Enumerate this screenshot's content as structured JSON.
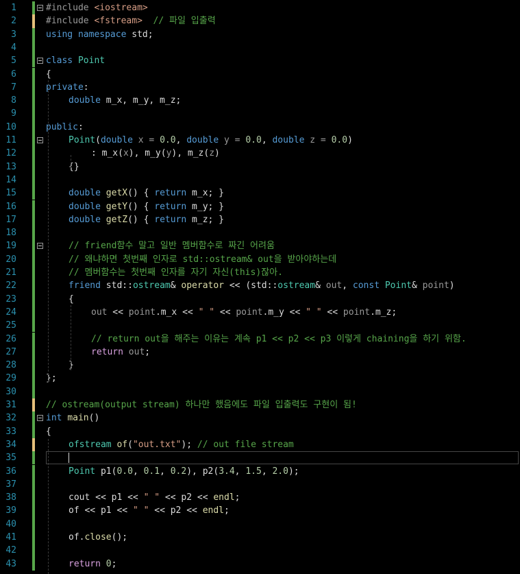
{
  "line_numbers": [
    "1",
    "2",
    "3",
    "4",
    "5",
    "6",
    "7",
    "8",
    "9",
    "10",
    "11",
    "12",
    "13",
    "14",
    "15",
    "16",
    "17",
    "18",
    "19",
    "20",
    "21",
    "22",
    "23",
    "24",
    "25",
    "26",
    "27",
    "28",
    "29",
    "30",
    "31",
    "32",
    "33",
    "34",
    "35",
    "36",
    "37",
    "38",
    "39",
    "40",
    "41",
    "42",
    "43"
  ],
  "code": {
    "l1": [
      "#include ",
      "<iostream>"
    ],
    "l2": [
      "#include ",
      "<fstream>",
      "  // 파일 입출력"
    ],
    "l3": [
      "using",
      " ",
      "namespace",
      " std;"
    ],
    "l5": [
      "class",
      " ",
      "Point"
    ],
    "l6": [
      "{"
    ],
    "l7": [
      "private",
      ":"
    ],
    "l8": [
      "double",
      " m_x, m_y, m_z;"
    ],
    "l10": [
      "public",
      ":"
    ],
    "l11": [
      "Point",
      "(",
      "double",
      " x = ",
      "0.0",
      ", ",
      "double",
      " y = ",
      "0.0",
      ", ",
      "double",
      " z = ",
      "0.0",
      ")"
    ],
    "l12": [
      ": m_x(",
      "x",
      "), m_y(",
      "y",
      "), m_z(",
      "z",
      ")"
    ],
    "l13": [
      "{}"
    ],
    "l15": [
      "double",
      " ",
      "getX",
      "() { ",
      "return",
      " m_x; }"
    ],
    "l16": [
      "double",
      " ",
      "getY",
      "() { ",
      "return",
      " m_y; }"
    ],
    "l17": [
      "double",
      " ",
      "getZ",
      "() { ",
      "return",
      " m_z; }"
    ],
    "l19": [
      "// friend함수 말고 일반 멤버함수로 짜긴 어려움"
    ],
    "l20": [
      "// 왜냐하면 첫번째 인자로 std::ostream& out을 받아야하는데"
    ],
    "l21": [
      "// 멤버함수는 첫번째 인자를 자기 자신(this)잖아."
    ],
    "l22": [
      "friend",
      " std::",
      "ostream",
      "& ",
      "operator",
      " << (std::",
      "ostream",
      "& ",
      "out",
      ", ",
      "const",
      " ",
      "Point",
      "& ",
      "point",
      ")"
    ],
    "l23": [
      "{"
    ],
    "l24": [
      "out",
      " << ",
      "point",
      ".m_x << ",
      "\" \"",
      " << ",
      "point",
      ".m_y << ",
      "\" \"",
      " << ",
      "point",
      ".m_z;"
    ],
    "l26": [
      "// return out을 해주는 이유는 계속 p1 << p2 << p3 이렇게 chaining을 하기 위함."
    ],
    "l27": [
      "return",
      " ",
      "out",
      ";"
    ],
    "l28": [
      "}"
    ],
    "l29": [
      "};"
    ],
    "l31": [
      "// ostream(output stream) 하나만 했음에도 파일 입출력도 구현이 됨!"
    ],
    "l32": [
      "int",
      " ",
      "main",
      "()"
    ],
    "l33": [
      "{"
    ],
    "l34": [
      "ofstream",
      " ",
      "of",
      "(",
      "\"out.txt\"",
      "); ",
      "// out file stream"
    ],
    "l36": [
      "Point",
      " p1(",
      "0.0",
      ", ",
      "0.1",
      ", ",
      "0.2",
      "), p2(",
      "3.4",
      ", ",
      "1.5",
      ", ",
      "2.0",
      ");"
    ],
    "l38": [
      "cout",
      " << p1 << ",
      "\" \"",
      " << p2 << ",
      "endl",
      ";"
    ],
    "l39": [
      "of",
      " << p1 << ",
      "\" \"",
      " << p2 << ",
      "endl",
      ";"
    ],
    "l41": [
      "of",
      ".",
      "close",
      "();"
    ],
    "l43": [
      "return",
      " ",
      "0",
      ";"
    ]
  },
  "colors": {
    "background": "#000000",
    "line_number": "#2b91af",
    "keyword": "#569cd6",
    "type": "#4ec9b0",
    "comment": "#57a64a",
    "string": "#d69d85",
    "number": "#b5cea8",
    "change_saved": "#57a64a",
    "change_unsaved": "#e5c07b"
  }
}
